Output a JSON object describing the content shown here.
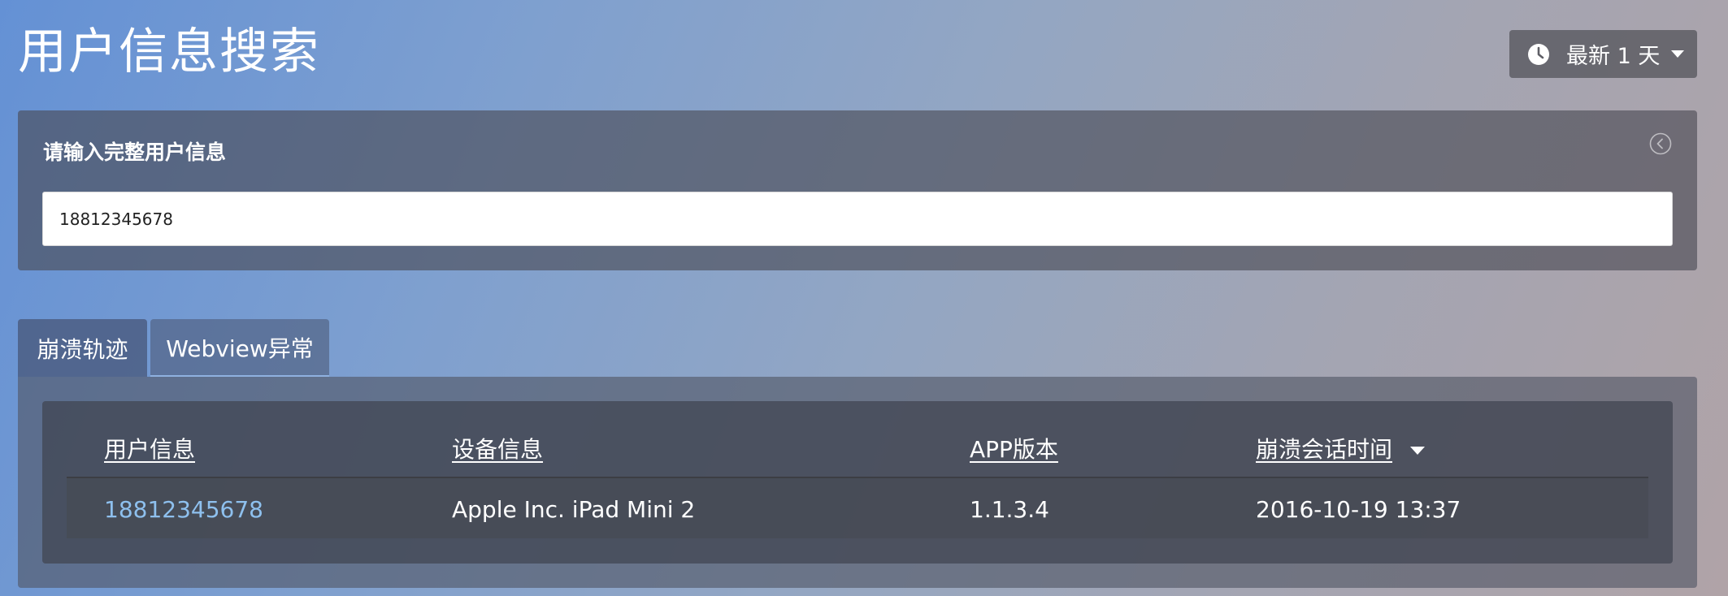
{
  "page": {
    "title": "用户信息搜索"
  },
  "time_range": {
    "icon": "clock-icon",
    "label": "最新 1 天"
  },
  "search_panel": {
    "title": "请输入完整用户信息",
    "collapse_icon": "chevron-left-circle-icon",
    "input_value": "18812345678"
  },
  "tabs": [
    {
      "label": "崩溃轨迹",
      "active": true
    },
    {
      "label": "Webview异常",
      "active": false
    }
  ],
  "table": {
    "columns": [
      {
        "label": "用户信息"
      },
      {
        "label": "设备信息"
      },
      {
        "label": "APP版本"
      },
      {
        "label": "崩溃会话时间",
        "sorted": "desc"
      }
    ],
    "rows": [
      [
        "18812345678",
        "Apple Inc. iPad Mini 2",
        "1.1.3.4",
        "2016-10-19 13:37"
      ]
    ]
  },
  "colors": {
    "link": "#8ec0ee",
    "panel": "#4a4c56",
    "text": "#ffffff"
  }
}
